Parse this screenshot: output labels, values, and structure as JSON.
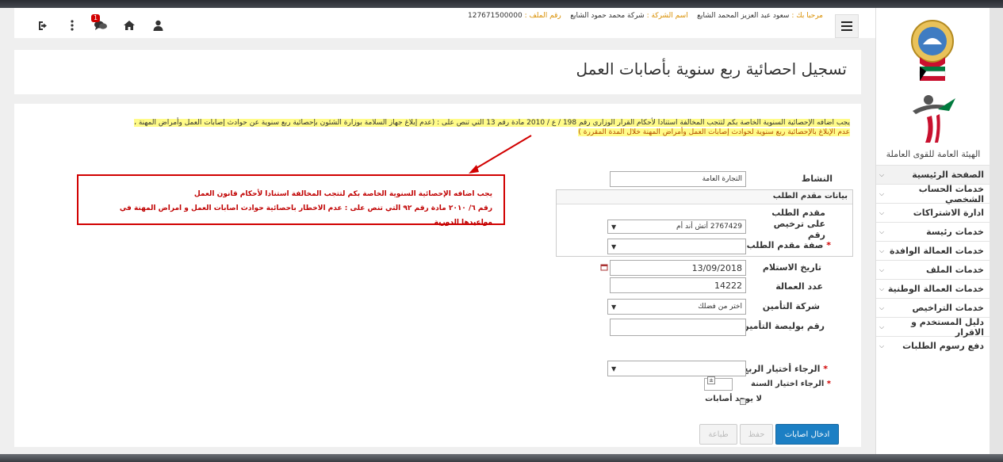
{
  "header": {
    "welcome_label": "مرحبا بك :",
    "welcome_name": "سعود عبد العزيز المحمد الشايع",
    "company_label": "اسم الشركة :",
    "company_name": "شركة محمد حمود الشايع",
    "file_label": "رقم الملف :",
    "file_number": "127671500000",
    "messages_badge": "1"
  },
  "sidebar": {
    "org_name": "الهيئة العامة للقوى العاملة",
    "items": [
      {
        "label": "الصفحة الرئيسية"
      },
      {
        "label": "خدمات الحساب الشخصي"
      },
      {
        "label": "ادارة الاشتراكات"
      },
      {
        "label": "خدمات رئيسة"
      },
      {
        "label": "خدمات العمالة الوافدة"
      },
      {
        "label": "خدمات الملف"
      },
      {
        "label": "خدمات العمالة الوطنية"
      },
      {
        "label": "خدمات التراخيص"
      },
      {
        "label": "دليل المستخدم و الاقرار"
      },
      {
        "label": "دفع رسوم الطلبات"
      }
    ]
  },
  "page": {
    "title": "تسجيل احصائية ربع سنوية بأصابات العمل"
  },
  "notice": {
    "line1": "يجب اضافه الإحصائية السنوية الخاصة بكم لتتجب المخالفة استنادا لأحكام القرار الوزاري رقم 198 / ع / 2010 مادة رقم 13 التي تنص على : (عدم إبلاغ جهاز السلامة بوزارة الشئون بإحصائية ربع سنوية عن حوادث إصابات العمل وأمراض المهنة ،",
    "line2": "عدم الإبلاغ بالإحصائية ربع سنوية لحوادث إصابات العمل وأمراض المهنة خلال المدة المقررة )"
  },
  "callout": {
    "line1": "يجب اضافه الإحصائية السنوية الخاصة بكم لتتجب المخالفة استنادا لأحكام قانون العمل",
    "line2": "رقم ٦/ ٢٠١٠ مادة رقم ٩٢ التي تنص على : عدم الاخطار باحصائية حوادث اصابات العمل و امراض المهنة في مواعيدها الدورية"
  },
  "form": {
    "activity_label": "النشاط",
    "activity_value": "التجارة العامة",
    "applicant_section": "بيانات مقدم الطلب",
    "applicant_license_label": "مقدم الطلب على ترخيص رقم",
    "applicant_license_value": "2767429 أتش أند أم",
    "applicant_role_label": "صفة مقدم الطلب",
    "applicant_role_value": "",
    "receipt_date_label": "تاريخ الاستلام",
    "receipt_date_value": "13/09/2018",
    "workers_label": "عدد العمالة",
    "workers_value": "14222",
    "insurance_company_label": "شركة التأمين",
    "insurance_company_value": "اختر من فضلك",
    "policy_number_label": "رقم بوليصة التأمين",
    "policy_number_value": "",
    "quarter_label": "الرجاء أختيار الربع",
    "quarter_value": "",
    "year_label": "الرجاء اختيار السنة",
    "year_value": "",
    "no_injuries_label": "لا يوجد أصابات",
    "required_mark": "*"
  },
  "buttons": {
    "enter_injuries": "ادخال اصابات",
    "save": "حفظ",
    "print": "طباعة"
  },
  "colors": {
    "accent": "#1c7fc4",
    "highlight": "#fffb88",
    "alert": "#d10000",
    "label_orange": "#d98f00"
  }
}
